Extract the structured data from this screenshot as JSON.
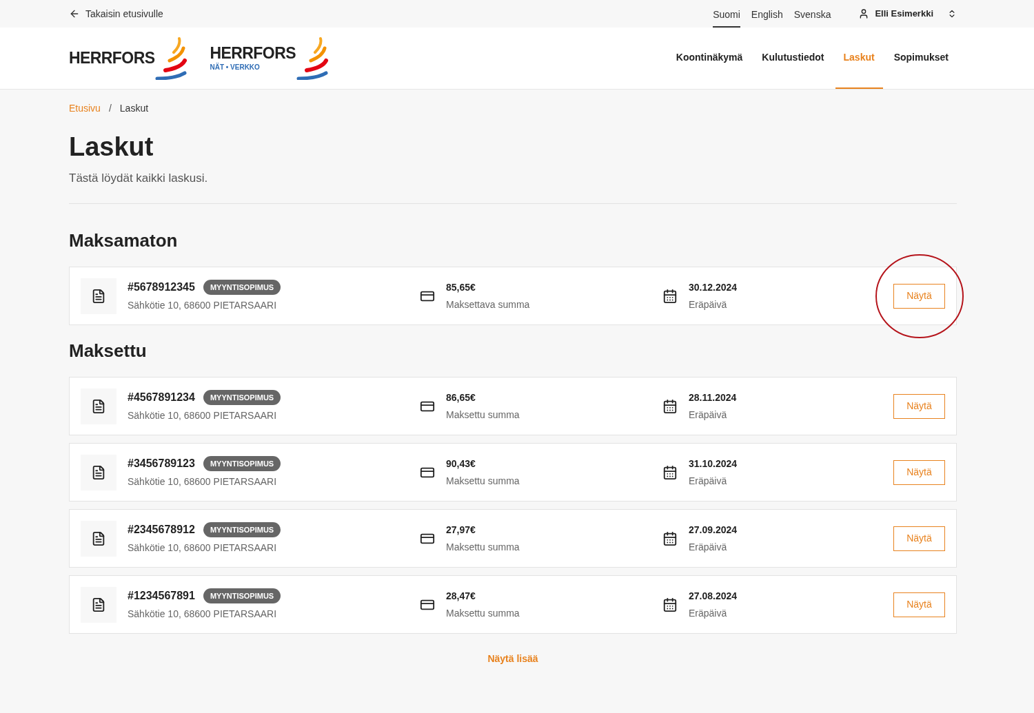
{
  "top_bar": {
    "back_link": "Takaisin etusivulle",
    "languages": [
      {
        "label": "Suomi",
        "selected": true
      },
      {
        "label": "English",
        "selected": false
      },
      {
        "label": "Svenska",
        "selected": false
      }
    ],
    "user": "Elli Esimerkki"
  },
  "logos": [
    {
      "name": "HERRFORS"
    },
    {
      "name": "HERRFORS",
      "subtitle": "NÄT • VERKKO"
    }
  ],
  "nav": [
    {
      "label": "Koontinäkymä",
      "selected": false
    },
    {
      "label": "Kulutustiedot",
      "selected": false
    },
    {
      "label": "Laskut",
      "selected": true
    },
    {
      "label": "Sopimukset",
      "selected": false
    }
  ],
  "breadcrumb": {
    "items": [
      "Etusivu",
      "Laskut"
    ],
    "separator": "/"
  },
  "title": "Laskut",
  "subtitle": "Tästä löydät kaikki laskusi.",
  "sections": [
    {
      "heading": "Maksamaton",
      "invoices": [
        {
          "number": "#5678912345",
          "tag": "MYYNTISOPIMUS",
          "address": "Sähkötie 10, 68600 PIETARSAARI",
          "amount": "85,65€",
          "amount_label": "Maksettava summa",
          "date": "30.12.2024",
          "date_label": "Eräpäivä",
          "button": "Näytä",
          "highlighted": true
        }
      ]
    },
    {
      "heading": "Maksettu",
      "invoices": [
        {
          "number": "#4567891234",
          "tag": "MYYNTISOPIMUS",
          "address": "Sähkötie 10, 68600 PIETARSAARI",
          "amount": "86,65€",
          "amount_label": "Maksettu summa",
          "date": "28.11.2024",
          "date_label": "Eräpäivä",
          "button": "Näytä",
          "highlighted": false
        },
        {
          "number": "#3456789123",
          "tag": "MYYNTISOPIMUS",
          "address": "Sähkötie 10, 68600 PIETARSAARI",
          "amount": "90,43€",
          "amount_label": "Maksettu summa",
          "date": "31.10.2024",
          "date_label": "Eräpäivä",
          "button": "Näytä",
          "highlighted": false
        },
        {
          "number": "#2345678912",
          "tag": "MYYNTISOPIMUS",
          "address": "Sähkötie 10, 68600 PIETARSAARI",
          "amount": "27,97€",
          "amount_label": "Maksettu summa",
          "date": "27.09.2024",
          "date_label": "Eräpäivä",
          "button": "Näytä",
          "highlighted": false
        },
        {
          "number": "#1234567891",
          "tag": "MYYNTISOPIMUS",
          "address": "Sähkötie 10, 68600 PIETARSAARI",
          "amount": "28,47€",
          "amount_label": "Maksettu summa",
          "date": "27.08.2024",
          "date_label": "Eräpäivä",
          "button": "Näytä",
          "highlighted": false
        }
      ]
    }
  ],
  "more_link": "Näytä lisää"
}
